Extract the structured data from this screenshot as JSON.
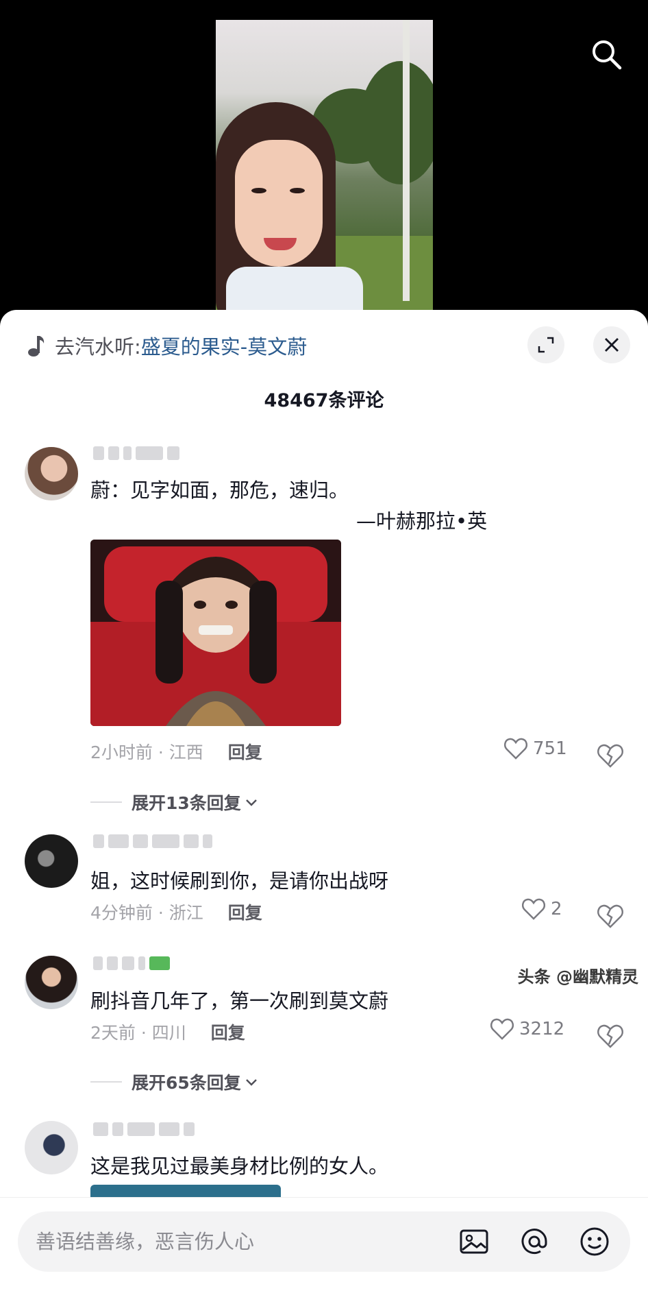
{
  "header": {
    "search_icon": "search-icon"
  },
  "sheet": {
    "music_prefix": "去汽水听:",
    "music_song": "盛夏的果实-莫文蔚",
    "comment_count": "48467条评论",
    "expand_icon": "expand-icon",
    "close_icon": "close-icon"
  },
  "comments": [
    {
      "text_line1": "蔚：见字如面，那危，速归。",
      "text_line2": "—叶赫那拉•英",
      "time": "2小时前 · 江西",
      "reply": "回复",
      "likes": "751",
      "expand": "展开13条回复"
    },
    {
      "text": "姐，这时候刷到你，是请你出战呀",
      "time": "4分钟前 · 浙江",
      "reply": "回复",
      "likes": "2"
    },
    {
      "text": "刷抖音几年了，第一次刷到莫文蔚",
      "time": "2天前 · 四川",
      "reply": "回复",
      "likes": "3212",
      "expand": "展开65条回复"
    },
    {
      "text": "这是我见过最美身材比例的女人。"
    }
  ],
  "input": {
    "placeholder": "善语结善缘，恶言伤人心",
    "icons": [
      "image-icon",
      "at-icon",
      "emoji-icon"
    ]
  },
  "watermark": "头条 @幽默精灵"
}
